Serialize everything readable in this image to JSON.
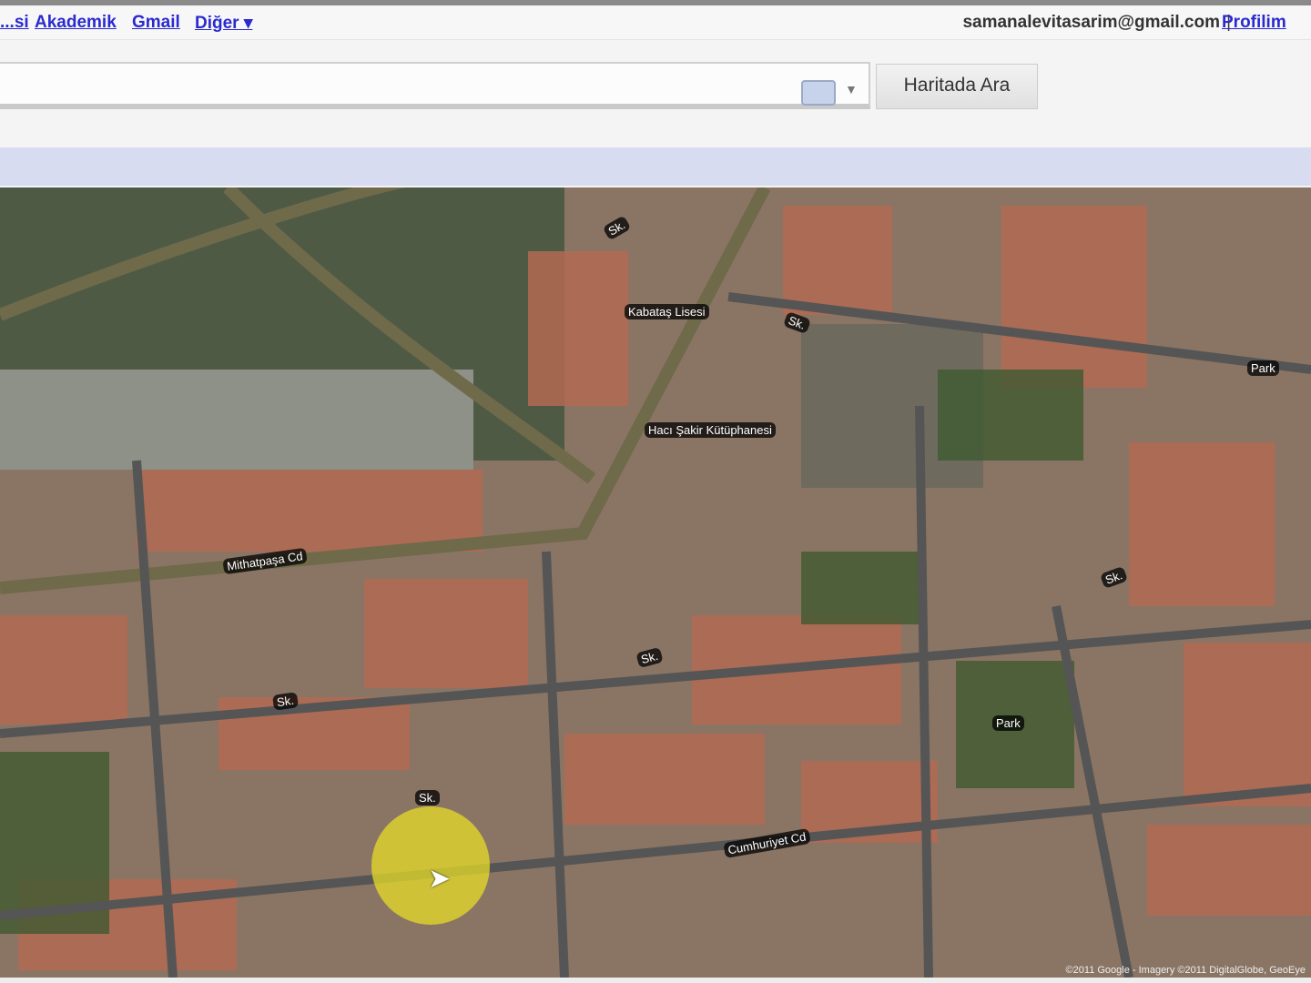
{
  "gbar": {
    "links": [
      "...si",
      "Akademik",
      "Gmail",
      "Diğer ▾"
    ],
    "email": "samanalevitasarim@gmail.com",
    "profile": "Profilim"
  },
  "search": {
    "value": "",
    "button": "Haritada Ara"
  },
  "map": {
    "labels": [
      "Kabataş Lisesi",
      "Hacı Şakir Kütüphanesi",
      "Mithatpaşa Cd",
      "Cumhuriyet Cd",
      "Park",
      "Park",
      "Sk.",
      "Sk.",
      "Sk.",
      "Sk.",
      "Sk.",
      "Sk."
    ],
    "copyright": "©2011 Google - Imagery ©2011 DigitalGlobe, GeoEye"
  }
}
